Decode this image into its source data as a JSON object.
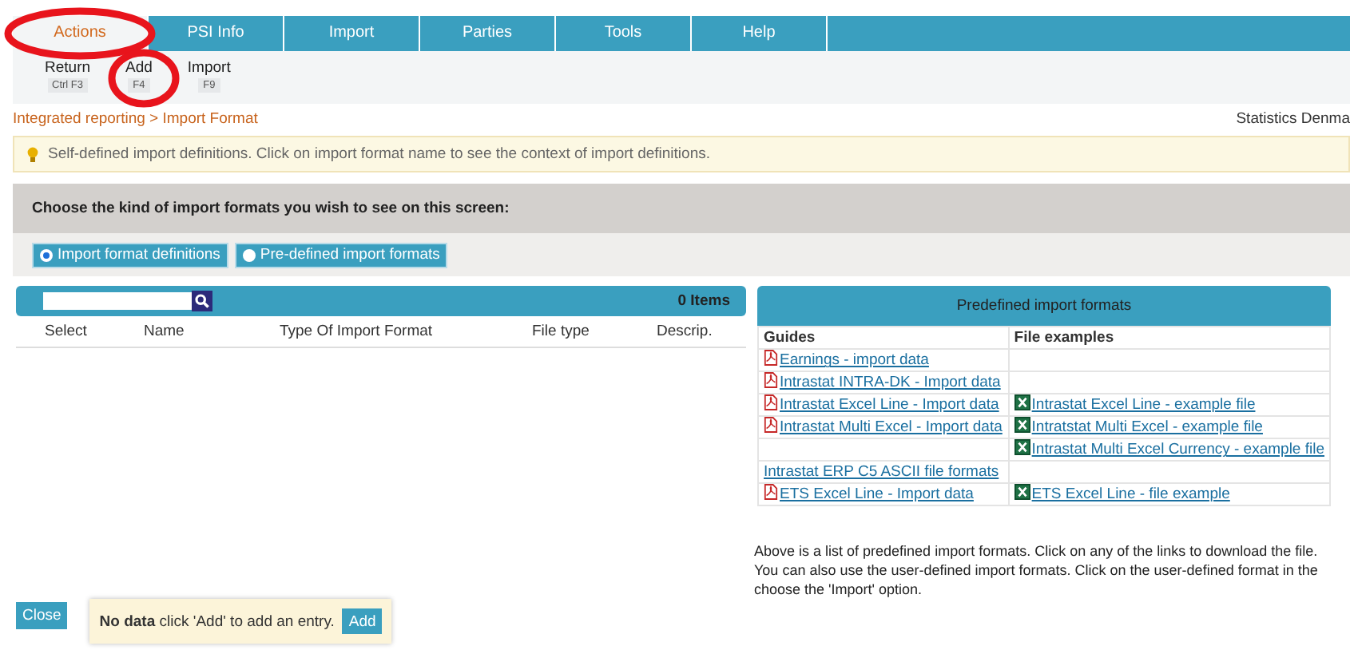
{
  "menu": [
    {
      "label": "Actions",
      "selected": true,
      "circled": true
    },
    {
      "label": "PSI Info",
      "selected": false,
      "circled": false
    },
    {
      "label": "Import",
      "selected": false,
      "circled": false
    },
    {
      "label": "Parties",
      "selected": false,
      "circled": false
    },
    {
      "label": "Tools",
      "selected": false,
      "circled": false
    },
    {
      "label": "Help",
      "selected": false,
      "circled": false
    }
  ],
  "toolbar": [
    {
      "label": "Return",
      "shortcut": "Ctrl F3",
      "circled": false
    },
    {
      "label": "Add",
      "shortcut": "F4",
      "circled": true
    },
    {
      "label": "Import",
      "shortcut": "F9",
      "circled": false
    }
  ],
  "breadcrumb": "Integrated reporting > Import Format",
  "organization": "Statistics Denma",
  "info_message": "Self-defined import definitions. Click on import format name to see the context of import definitions.",
  "chooser": {
    "title": "Choose the kind of import formats you wish to see on this screen:",
    "options": [
      {
        "label": "Import format definitions",
        "selected": true
      },
      {
        "label": "Pre-defined import formats",
        "selected": false
      }
    ]
  },
  "list": {
    "count": "0 Items",
    "columns": [
      "Select",
      "Name",
      "Type Of Import Format",
      "File type",
      "Descrip."
    ]
  },
  "predefined": {
    "title": "Predefined import formats",
    "columns": [
      "Guides",
      "File examples"
    ],
    "rows": [
      {
        "guide": {
          "text": "Earnings - import data",
          "kind": "pdf"
        }
      },
      {
        "guide": {
          "text": "Intrastat INTRA-DK - Import data",
          "kind": "pdf"
        }
      },
      {
        "guide": {
          "text": "Intrastat Excel Line - Import data",
          "kind": "pdf"
        },
        "example": {
          "text": "Intrastat Excel Line - example file",
          "kind": "excel"
        }
      },
      {
        "guide": {
          "text": "Intrastat Multi Excel - Import data",
          "kind": "pdf"
        },
        "example": {
          "text": "Intratstat Multi Excel - example file",
          "kind": "excel"
        }
      },
      {
        "example": {
          "text": "Intrastat Multi Excel Currency - example file",
          "kind": "excel"
        }
      },
      {
        "guide": {
          "text": "Intrastat ERP C5 ASCII file formats",
          "kind": "plain"
        }
      },
      {
        "guide": {
          "text": "ETS Excel Line - Import data",
          "kind": "pdf"
        },
        "example": {
          "text": "ETS Excel Line - file example",
          "kind": "excel"
        }
      }
    ]
  },
  "note_lines": [
    "Above is a list of predefined import formats. Click on any of the links to download the file.",
    "You can also use the user-defined import formats. Click on the user-defined format in the",
    "choose the 'Import' option."
  ],
  "close_button": "Close",
  "empty_note": {
    "text": "**No data** click 'Add' to add an entry.",
    "button": "Add"
  }
}
